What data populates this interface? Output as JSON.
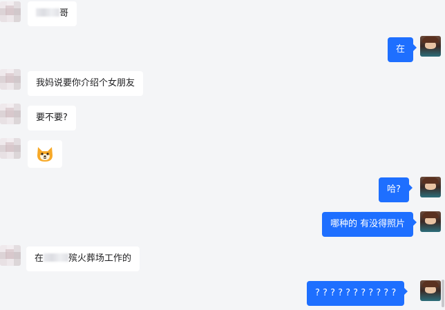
{
  "messages": [
    {
      "side": "left",
      "text": "哥",
      "blurred_prefix": true
    },
    {
      "side": "right",
      "text": "在"
    },
    {
      "side": "left",
      "text": "我妈说要你介绍个女朋友"
    },
    {
      "side": "left",
      "text": "要不要?"
    },
    {
      "side": "left",
      "sticker": "shiba-dog-emoji"
    },
    {
      "side": "right",
      "text": "哈?"
    },
    {
      "side": "right",
      "text": "哪种的 有没得照片"
    },
    {
      "side": "left",
      "text_before": "在",
      "text_after": "殡火葬场工作的",
      "blurred_middle": true
    },
    {
      "side": "right",
      "text": "? ? ? ? ? ? ? ? ? ? ?"
    }
  ],
  "colors": {
    "background": "#f4f5f7",
    "incoming_bubble": "#ffffff",
    "outgoing_bubble": "#1e6fff"
  }
}
